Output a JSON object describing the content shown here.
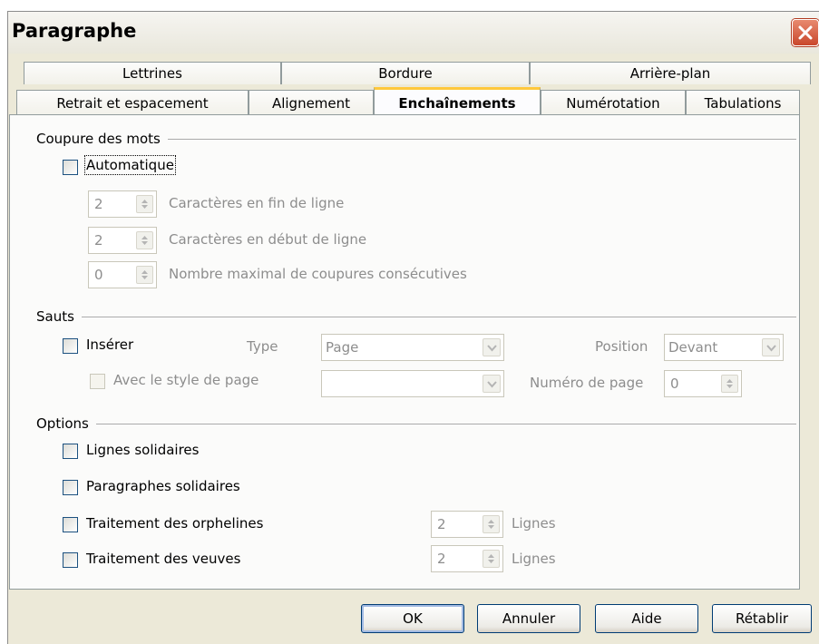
{
  "window": {
    "title": "Paragraphe"
  },
  "tabs": {
    "row1": [
      "Lettrines",
      "Bordure",
      "Arrière-plan"
    ],
    "row2": [
      "Retrait et espacement",
      "Alignement",
      "Enchaînements",
      "Numérotation",
      "Tabulations"
    ],
    "active": "Enchaînements"
  },
  "hyphenation": {
    "section_label": "Coupure des mots",
    "automatic_label": "Automatique",
    "automatic_checked": false,
    "chars_end_value": "2",
    "chars_end_label": "Caractères en fin de ligne",
    "chars_start_value": "2",
    "chars_start_label": "Caractères en début de ligne",
    "max_consecutive_value": "0",
    "max_consecutive_label": "Nombre maximal de coupures consécutives"
  },
  "breaks": {
    "section_label": "Sauts",
    "insert_label": "Insérer",
    "insert_checked": false,
    "type_label": "Type",
    "type_value": "Page",
    "position_label": "Position",
    "position_value": "Devant",
    "with_page_style_label": "Avec le style de page",
    "page_style_value": "",
    "page_number_label": "Numéro de page",
    "page_number_value": "0"
  },
  "options": {
    "section_label": "Options",
    "keep_lines_label": "Lignes solidaires",
    "keep_paragraphs_label": "Paragraphes solidaires",
    "orphan_label": "Traitement des orphelines",
    "orphan_value": "2",
    "orphan_unit": "Lignes",
    "widow_label": "Traitement des veuves",
    "widow_value": "2",
    "widow_unit": "Lignes"
  },
  "buttons": {
    "ok": "OK",
    "cancel": "Annuler",
    "help": "Aide",
    "reset": "Rétablir"
  },
  "icons": {
    "close": "close-icon",
    "spin": "spin-arrows-icon",
    "dropdown": "chevron-down-icon"
  },
  "colors": {
    "close_button": "#c9472c",
    "active_tab_accent": "#ffc83c",
    "disabled_text": "#8d8d8d"
  }
}
